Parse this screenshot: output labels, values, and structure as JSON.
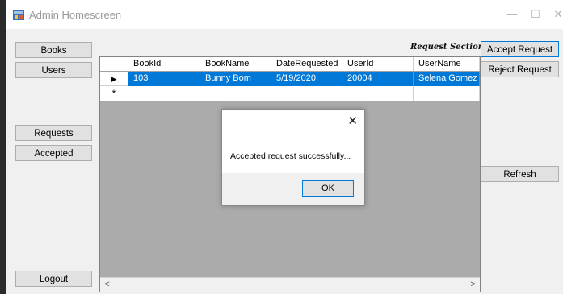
{
  "window": {
    "title": "Admin Homescreen",
    "minimize": "—",
    "maximize": "☐",
    "close": "✕"
  },
  "nav": {
    "books": "Books",
    "users": "Users",
    "requests": "Requests",
    "accepted": "Accepted",
    "logout": "Logout"
  },
  "section_label": "Request Section",
  "actions": {
    "accept": "Accept Request",
    "reject": "Reject Request",
    "refresh": "Refresh"
  },
  "grid": {
    "columns": [
      "BookId",
      "BookName",
      "DateRequested",
      "UserId",
      "UserName"
    ],
    "rows": [
      [
        "103",
        "Bunny Bom",
        "5/19/2020",
        "20004",
        "Selena Gomez"
      ]
    ],
    "selected_row_marker": "▶",
    "new_row_marker": "*",
    "scroll_left": "<",
    "scroll_right": ">"
  },
  "dialog": {
    "message": "Accepted request successfully...",
    "ok": "OK",
    "close": "✕"
  },
  "colors": {
    "accent": "#0078d7",
    "grid_bg": "#ababab"
  }
}
